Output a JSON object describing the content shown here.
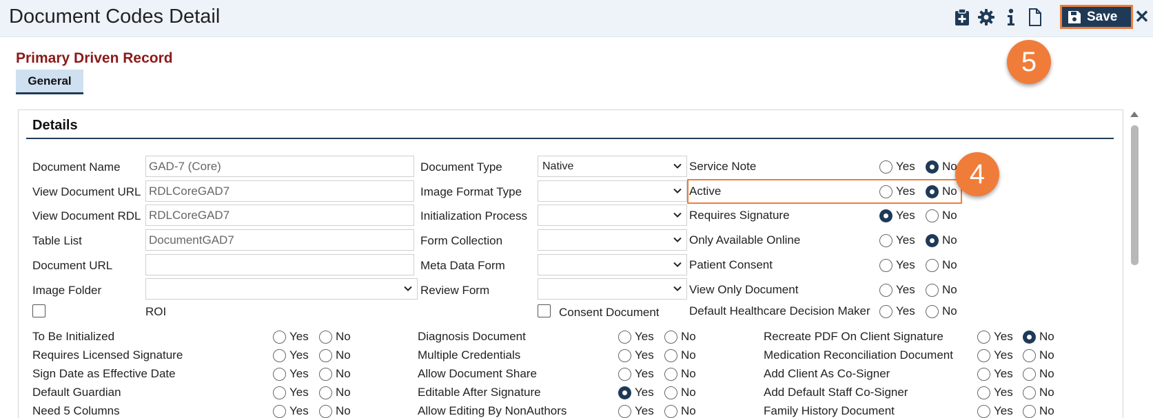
{
  "header": {
    "title": "Document Codes Detail",
    "icons": [
      "clipboard-plus-icon",
      "gear-icon",
      "info-icon",
      "document-icon"
    ],
    "save_label": "Save",
    "close_glyph": "✕"
  },
  "callouts": {
    "save_step": "5",
    "active_step": "4"
  },
  "record_title": "Primary Driven Record",
  "tabs": [
    {
      "label": "General",
      "selected": true
    }
  ],
  "details": {
    "section_title": "Details",
    "text_fields": [
      {
        "label": "Document Name",
        "value": "GAD-7 (Core)"
      },
      {
        "label": "View Document URL",
        "value": "RDLCoreGAD7"
      },
      {
        "label": "View Document RDL",
        "value": "RDLCoreGAD7"
      },
      {
        "label": "Table List",
        "value": "DocumentGAD7"
      },
      {
        "label": "Document URL",
        "value": ""
      },
      {
        "label": "Image Folder",
        "value": ""
      }
    ],
    "roi_label": "ROI",
    "dropdowns": [
      {
        "label": "Document Type",
        "value": "Native"
      },
      {
        "label": "Image Format Type",
        "value": ""
      },
      {
        "label": "Initialization Process",
        "value": ""
      },
      {
        "label": "Form Collection",
        "value": ""
      },
      {
        "label": "Meta Data Form",
        "value": ""
      },
      {
        "label": "Review Form",
        "value": ""
      }
    ],
    "consent_label": "Consent Document",
    "yes_label": "Yes",
    "no_label": "No",
    "right_radios": [
      {
        "label": "Service Note",
        "value": "No"
      },
      {
        "label": "Active",
        "value": "No"
      },
      {
        "label": "Requires Signature",
        "value": "Yes"
      },
      {
        "label": "Only Available Online",
        "value": "No"
      },
      {
        "label": "Patient Consent",
        "value": ""
      },
      {
        "label": "View Only Document",
        "value": ""
      },
      {
        "label": "Default Healthcare Decision Maker",
        "value": ""
      }
    ],
    "grid_col1": [
      {
        "label": "To Be Initialized",
        "value": ""
      },
      {
        "label": "Requires Licensed Signature",
        "value": ""
      },
      {
        "label": "Sign Date as Effective Date",
        "value": ""
      },
      {
        "label": "Default Guardian",
        "value": ""
      },
      {
        "label": "Need 5 Columns",
        "value": ""
      }
    ],
    "grid_col2": [
      {
        "label": "Diagnosis Document",
        "value": ""
      },
      {
        "label": "Multiple Credentials",
        "value": ""
      },
      {
        "label": "Allow Document Share",
        "value": ""
      },
      {
        "label": "Editable After Signature",
        "value": "Yes"
      },
      {
        "label": "Allow Editing By NonAuthors",
        "value": ""
      }
    ],
    "grid_col3": [
      {
        "label": "Recreate PDF On Client Signature",
        "value": "No"
      },
      {
        "label": "Medication Reconciliation Document",
        "value": ""
      },
      {
        "label": "Add Client As Co-Signer",
        "value": ""
      },
      {
        "label": "Add Default Staff Co-Signer",
        "value": ""
      },
      {
        "label": "Family History Document",
        "value": ""
      }
    ]
  },
  "colors": {
    "accent": "#1f3a57",
    "highlight": "#ee7d3a",
    "record_title": "#8b1a1a",
    "tab_bg": "#cfe0f0"
  }
}
